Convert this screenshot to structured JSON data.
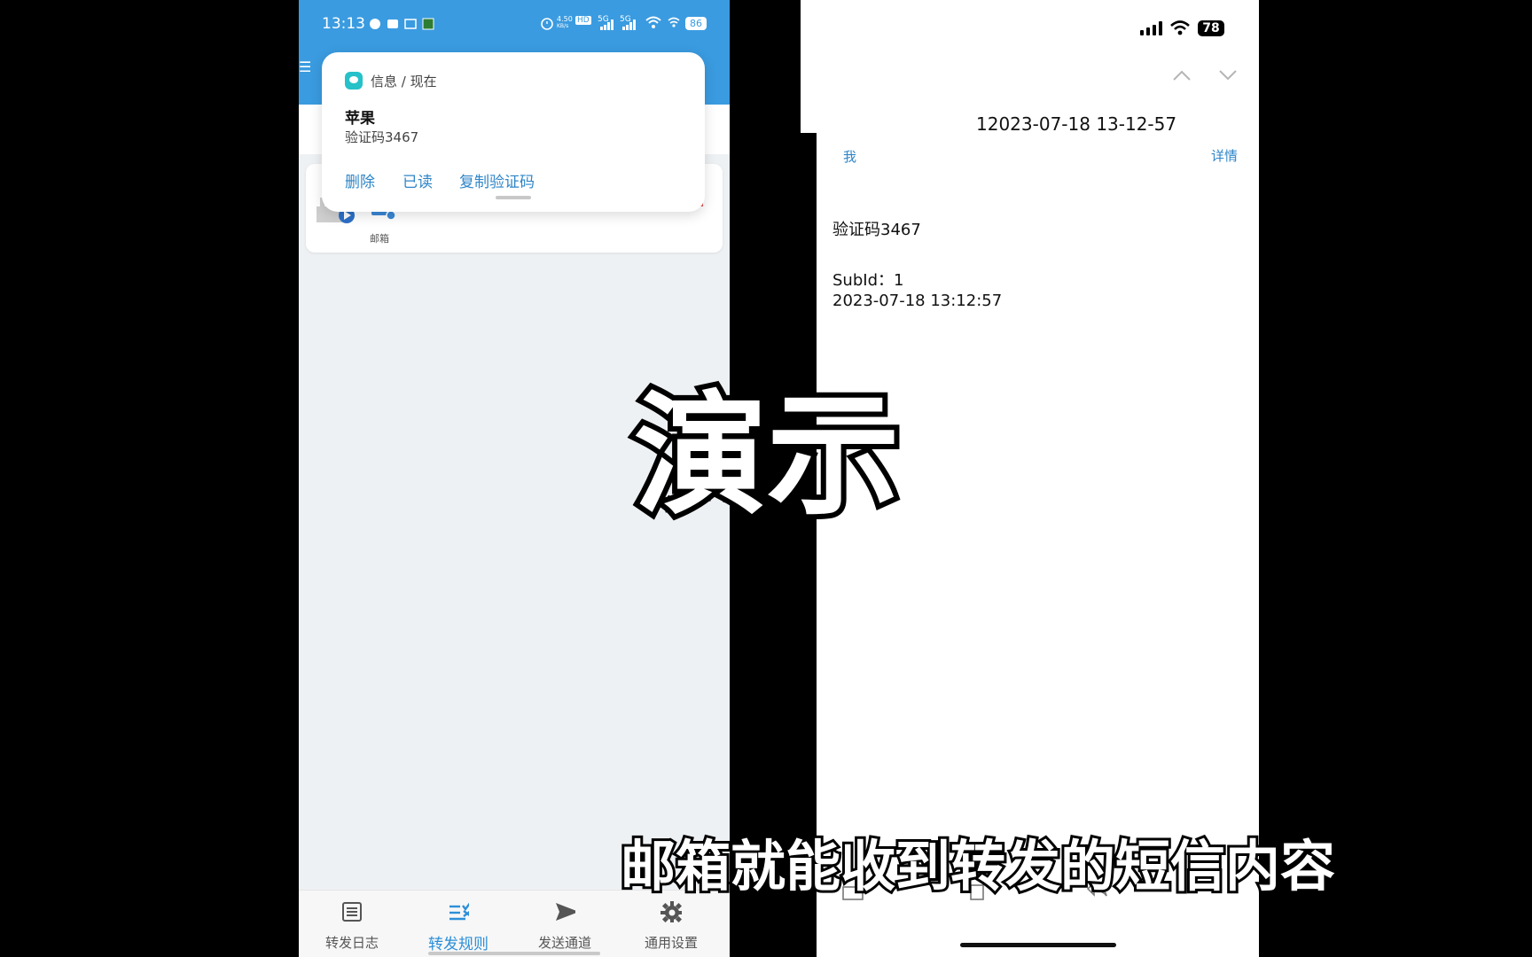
{
  "left_phone": {
    "status": {
      "time": "13:13",
      "net_speed": "4.50",
      "net_unit": "KB/s",
      "hd": "HD",
      "net1": "5G",
      "net2": "5G",
      "battery": "86"
    },
    "notification": {
      "app_header": "信息 / 现在",
      "title": "苹果",
      "body": "验证码3467",
      "actions": [
        "删除",
        "已读",
        "复制验证码"
      ]
    },
    "rule_card": {
      "mail_label": "邮箱"
    },
    "bottom_nav": [
      {
        "label": "转发日志",
        "icon": "list-icon"
      },
      {
        "label": "转发规则",
        "icon": "rules-icon"
      },
      {
        "label": "发送通道",
        "icon": "send-icon"
      },
      {
        "label": "通用设置",
        "icon": "gear-icon"
      }
    ]
  },
  "right_phone": {
    "status": {
      "battery": "78"
    },
    "mail": {
      "subject": "12023-07-18 13-12-57",
      "sender": "我",
      "details_link": "详情",
      "body_line1": "验证码3467",
      "body_line2": "SubId：1",
      "body_line3": "2023-07-18 13:12:57"
    }
  },
  "captions": {
    "main": "演示",
    "subtitle": "邮箱就能收到转发的短信内容"
  },
  "colors": {
    "left_header": "#3a9be0",
    "accent": "#2f86c8",
    "active_nav": "#2d8fd8"
  }
}
